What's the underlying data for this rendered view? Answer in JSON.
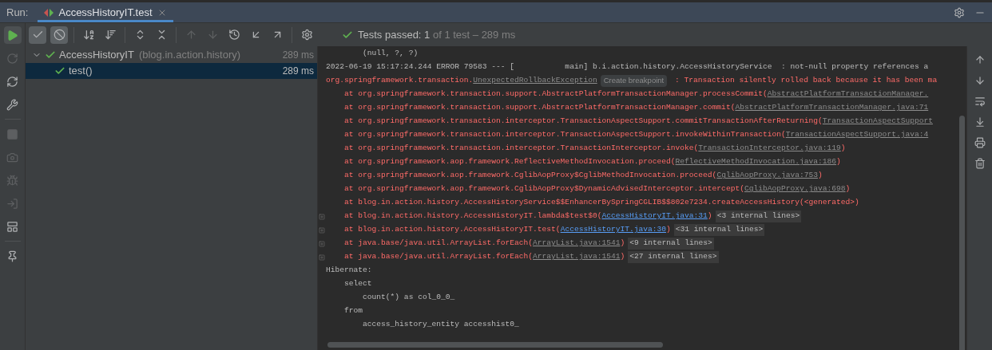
{
  "header": {
    "label": "Run:",
    "tabs": [
      {
        "title": "AccessHistoryIT.test",
        "selected": true
      }
    ]
  },
  "toolbar": [
    {
      "kind": "show-passed",
      "selected": true
    },
    {
      "kind": "show-ignored",
      "selected": true
    },
    {
      "kind": "sort-alpha",
      "selected": false
    },
    {
      "kind": "sort-duration",
      "selected": false
    },
    {
      "kind": "expand-all",
      "selected": false
    },
    {
      "kind": "collapse-all",
      "selected": false
    },
    {
      "kind": "prev",
      "disabled": true
    },
    {
      "kind": "next",
      "disabled": true
    },
    {
      "kind": "history",
      "selected": false
    },
    {
      "kind": "import",
      "selected": false
    },
    {
      "kind": "export",
      "selected": false
    },
    {
      "kind": "settings",
      "selected": false
    }
  ],
  "status": {
    "passed": true,
    "main": "Tests passed: 1",
    "rest": " of 1 test – 289 ms"
  },
  "left_tools": [
    {
      "kind": "run",
      "disabled": false
    },
    {
      "kind": "rerun-failed",
      "disabled": true
    },
    {
      "kind": "auto-test",
      "disabled": false
    },
    {
      "kind": "wrench",
      "disabled": false
    },
    {
      "kind": "stop",
      "disabled": true
    },
    {
      "kind": "camera",
      "disabled": true
    },
    {
      "kind": "debug",
      "disabled": true
    },
    {
      "kind": "exit",
      "disabled": true
    },
    {
      "kind": "layout",
      "disabled": false
    },
    {
      "kind": "pin",
      "disabled": false
    }
  ],
  "tree": [
    {
      "name": "AccessHistoryIT",
      "package": "(blog.in.action.history)",
      "duration": "289 ms",
      "passed": true,
      "expanded": true,
      "selected": false,
      "children": [
        {
          "name": "test()",
          "duration": "289 ms",
          "passed": true,
          "selected": true
        }
      ]
    }
  ],
  "console": [
    {
      "fold": false,
      "error": false,
      "segments": [
        {
          "kind": "text",
          "text": "        (null, ?, ?)"
        }
      ]
    },
    {
      "fold": false,
      "error": false,
      "segments": [
        {
          "kind": "text",
          "text": "2022-06-19 15:17:24.244 ERROR 79583 --- [           main] b.i.action.history.AccessHistoryService  : not-null property references a"
        }
      ]
    },
    {
      "fold": false,
      "error": true,
      "segments": [
        {
          "kind": "text",
          "text": "org.springframework.transaction."
        },
        {
          "kind": "link",
          "text": "UnexpectedRollbackException"
        },
        {
          "kind": "hint",
          "text": "Create breakpoint"
        },
        {
          "kind": "text",
          "text": " : Transaction silently rolled back because it has been ma"
        }
      ]
    },
    {
      "fold": false,
      "error": true,
      "segments": [
        {
          "kind": "text",
          "text": "    at org.springframework.transaction.support.AbstractPlatformTransactionManager.processCommit("
        },
        {
          "kind": "link",
          "text": "AbstractPlatformTransactionManager."
        }
      ]
    },
    {
      "fold": false,
      "error": true,
      "segments": [
        {
          "kind": "text",
          "text": "    at org.springframework.transaction.support.AbstractPlatformTransactionManager.commit("
        },
        {
          "kind": "link",
          "text": "AbstractPlatformTransactionManager.java:71"
        }
      ]
    },
    {
      "fold": false,
      "error": true,
      "segments": [
        {
          "kind": "text",
          "text": "    at org.springframework.transaction.interceptor.TransactionAspectSupport.commitTransactionAfterReturning("
        },
        {
          "kind": "link",
          "text": "TransactionAspectSupport"
        }
      ]
    },
    {
      "fold": false,
      "error": true,
      "segments": [
        {
          "kind": "text",
          "text": "    at org.springframework.transaction.interceptor.TransactionAspectSupport.invokeWithinTransaction("
        },
        {
          "kind": "link",
          "text": "TransactionAspectSupport.java:4"
        }
      ]
    },
    {
      "fold": false,
      "error": true,
      "segments": [
        {
          "kind": "text",
          "text": "    at org.springframework.transaction.interceptor.TransactionInterceptor.invoke("
        },
        {
          "kind": "link",
          "text": "TransactionInterceptor.java:119"
        },
        {
          "kind": "text",
          "text": ")"
        }
      ]
    },
    {
      "fold": false,
      "error": true,
      "segments": [
        {
          "kind": "text",
          "text": "    at org.springframework.aop.framework.ReflectiveMethodInvocation.proceed("
        },
        {
          "kind": "link",
          "text": "ReflectiveMethodInvocation.java:186"
        },
        {
          "kind": "text",
          "text": ")"
        }
      ]
    },
    {
      "fold": false,
      "error": true,
      "segments": [
        {
          "kind": "text",
          "text": "    at org.springframework.aop.framework.CglibAopProxy$CglibMethodInvocation.proceed("
        },
        {
          "kind": "link",
          "text": "CglibAopProxy.java:753"
        },
        {
          "kind": "text",
          "text": ")"
        }
      ]
    },
    {
      "fold": false,
      "error": true,
      "segments": [
        {
          "kind": "text",
          "text": "    at org.springframework.aop.framework.CglibAopProxy$DynamicAdvisedInterceptor.intercept("
        },
        {
          "kind": "link",
          "text": "CglibAopProxy.java:698"
        },
        {
          "kind": "text",
          "text": ")"
        }
      ]
    },
    {
      "fold": false,
      "error": true,
      "segments": [
        {
          "kind": "text",
          "text": "    at blog.in.action.history.AccessHistoryService$$EnhancerBySpringCGLIB$$802e7234.createAccessHistory(<generated>)"
        }
      ]
    },
    {
      "fold": true,
      "error": true,
      "segments": [
        {
          "kind": "text",
          "text": "    at blog.in.action.history.AccessHistoryIT.lambda$test$0("
        },
        {
          "kind": "source_link",
          "text": "AccessHistoryIT.java:31"
        },
        {
          "kind": "text",
          "text": ")"
        },
        {
          "kind": "badge",
          "text": "<3 internal lines>"
        }
      ]
    },
    {
      "fold": true,
      "error": true,
      "segments": [
        {
          "kind": "text",
          "text": "    at blog.in.action.history.AccessHistoryIT.test("
        },
        {
          "kind": "source_link",
          "text": "AccessHistoryIT.java:30"
        },
        {
          "kind": "text",
          "text": ")"
        },
        {
          "kind": "badge",
          "text": "<31 internal lines>"
        }
      ]
    },
    {
      "fold": true,
      "error": true,
      "segments": [
        {
          "kind": "text",
          "text": "    at java.base/java.util.ArrayList.forEach("
        },
        {
          "kind": "link",
          "text": "ArrayList.java:1541"
        },
        {
          "kind": "text",
          "text": ")"
        },
        {
          "kind": "badge",
          "text": "<9 internal lines>"
        }
      ]
    },
    {
      "fold": true,
      "error": true,
      "segments": [
        {
          "kind": "text",
          "text": "    at java.base/java.util.ArrayList.forEach("
        },
        {
          "kind": "link",
          "text": "ArrayList.java:1541"
        },
        {
          "kind": "text",
          "text": ")"
        },
        {
          "kind": "badge",
          "text": "<27 internal lines>"
        }
      ]
    },
    {
      "fold": false,
      "error": false,
      "segments": [
        {
          "kind": "text",
          "text": "Hibernate:"
        }
      ]
    },
    {
      "fold": false,
      "error": false,
      "segments": [
        {
          "kind": "text",
          "text": "    select"
        }
      ]
    },
    {
      "fold": false,
      "error": false,
      "segments": [
        {
          "kind": "text",
          "text": "        count(*) as col_0_0_"
        }
      ]
    },
    {
      "fold": false,
      "error": false,
      "segments": [
        {
          "kind": "text",
          "text": "    from"
        }
      ]
    },
    {
      "fold": false,
      "error": false,
      "segments": [
        {
          "kind": "text",
          "text": "        access_history_entity accesshist0_"
        }
      ]
    }
  ],
  "right_tools": [
    {
      "kind": "up"
    },
    {
      "kind": "down"
    },
    {
      "kind": "wrap"
    },
    {
      "kind": "scroll-end"
    },
    {
      "kind": "print"
    },
    {
      "kind": "trash"
    }
  ]
}
